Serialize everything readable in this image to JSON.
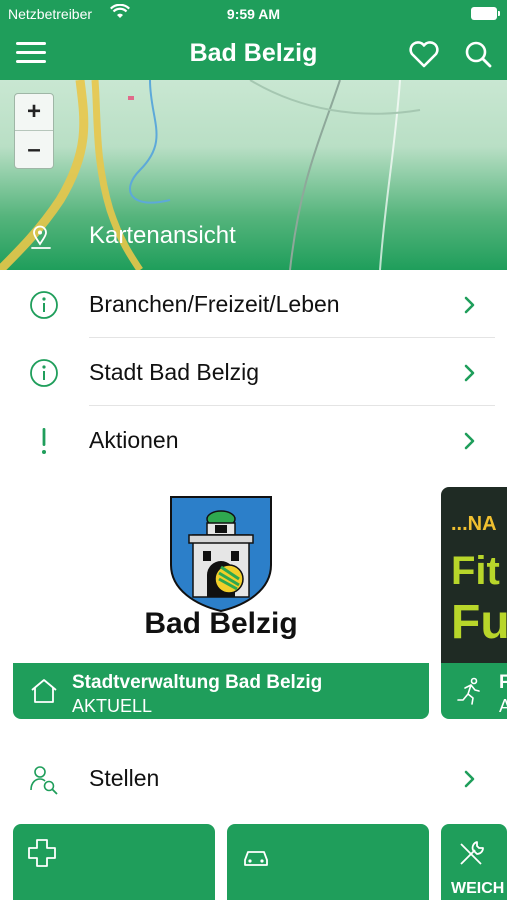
{
  "status": {
    "carrier": "Netzbetreiber",
    "time": "9:59 AM"
  },
  "nav": {
    "title": "Bad Belzig"
  },
  "map": {
    "zoom_in": "+",
    "zoom_out": "–",
    "label": "Kartenansicht"
  },
  "rows": [
    {
      "label": "Branchen/Freizeit/Leben",
      "icon": "info-icon"
    },
    {
      "label": "Stadt Bad Belzig",
      "icon": "info-icon"
    },
    {
      "label": "Aktionen",
      "icon": "exclamation-icon"
    }
  ],
  "cards": [
    {
      "logo_text": "Bad Belzig",
      "title": "Stadtverwaltung Bad Belzig",
      "subtitle": "AKTUELL",
      "icon": "home-icon"
    },
    {
      "poster_text": [
        "...NA",
        "Fit",
        "Fu"
      ],
      "title": "F",
      "subtitle": "A",
      "icon": "runner-icon"
    }
  ],
  "stellen": {
    "label": "Stellen",
    "icon": "person-search-icon"
  },
  "tiles": [
    {
      "icon": "medical-cross-icon"
    },
    {
      "icon": "car-icon"
    },
    {
      "icon": "tools-icon",
      "label": "WEICH"
    }
  ],
  "colors": {
    "primary": "#1f9e5b",
    "accent_icon": "#1f9e5b"
  }
}
